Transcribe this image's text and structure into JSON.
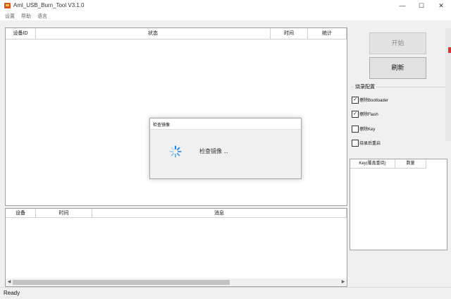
{
  "window": {
    "title": "Aml_USB_Burn_Tool V3.1.0",
    "min_glyph": "—",
    "max_glyph": "☐",
    "close_glyph": "✕"
  },
  "menu": [
    "设置",
    "帮助",
    "语言"
  ],
  "device_table": {
    "headers": [
      "设备ID",
      "状态",
      "时间",
      "统计"
    ]
  },
  "log_table": {
    "headers": [
      "设备",
      "时间",
      "消息"
    ],
    "arrow_left": "◀",
    "arrow_right": "▶"
  },
  "buttons": {
    "start": "开始",
    "refresh": "刷新"
  },
  "burn_config": {
    "title": "烧录配置",
    "options": [
      {
        "label": "擦除Bootloader",
        "checked": true
      },
      {
        "label": "擦除Flash",
        "checked": true
      },
      {
        "label": "擦除Key",
        "checked": false
      },
      {
        "label": "烧录后重启",
        "checked": false
      }
    ]
  },
  "key_table": {
    "headers": [
      "Key(覆盖重烧)",
      "数量"
    ]
  },
  "dialog": {
    "title": "检查镜像",
    "message": "检查镜像 ..."
  },
  "status": "Ready",
  "colors": {
    "accent": "#1e7fd8",
    "app_icon": "#d9531e"
  }
}
